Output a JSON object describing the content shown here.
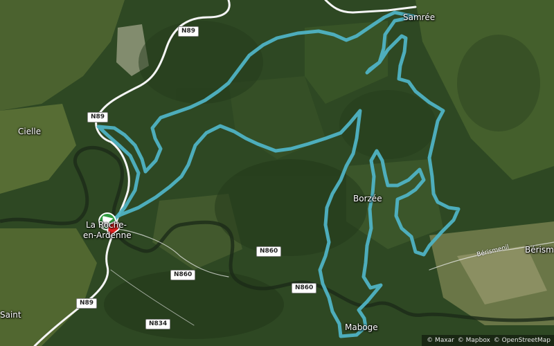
{
  "map": {
    "places": {
      "samree": "Samrée",
      "cielle": "Cielle",
      "la_roche_line1": "La Roche-",
      "la_roche_line2": "en-Ardenne",
      "borzee": "Borzée",
      "maboge": "Maboge",
      "berismenil": "Bérism",
      "berismenil_road": "Bérismenil",
      "saint": "Saint"
    },
    "road_shields": {
      "n89_top": "N89",
      "n89_left": "N89",
      "n89_bottom": "N89",
      "n860_a": "N860",
      "n860_b": "N860",
      "n860_c": "N860",
      "n834": "N834"
    },
    "attribution": {
      "maxar": "© Maxar",
      "mapbox": "© Mapbox",
      "osm": "© OpenStreetMap"
    },
    "colors": {
      "route": "#4fb3c4",
      "start_marker": "#ffffff",
      "start_marker_green": "#2e9a3e",
      "end_marker": "#e02020",
      "road": "#f5f5f5"
    }
  }
}
